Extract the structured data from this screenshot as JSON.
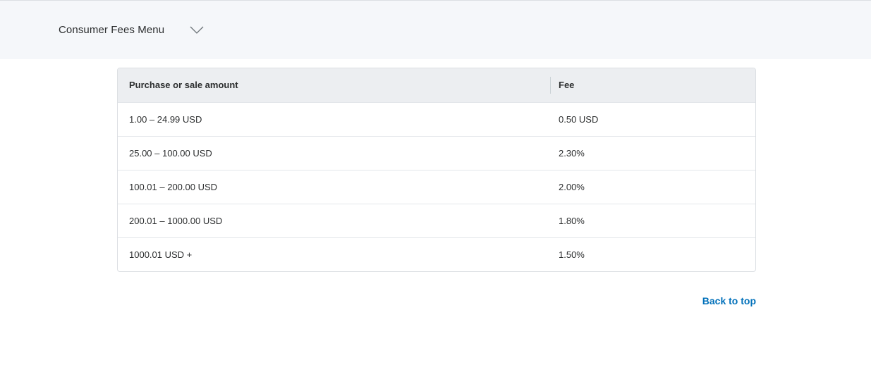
{
  "menu": {
    "label": "Consumer Fees Menu",
    "chevron_icon": "chevron-down-icon"
  },
  "table": {
    "headers": {
      "amount": "Purchase or sale amount",
      "fee": "Fee"
    },
    "rows": [
      {
        "amount": "1.00 – 24.99 USD",
        "fee": "0.50 USD"
      },
      {
        "amount": "25.00 – 100.00 USD",
        "fee": "2.30%"
      },
      {
        "amount": "100.01 – 200.00 USD",
        "fee": "2.00%"
      },
      {
        "amount": "200.01 – 1000.00 USD",
        "fee": "1.80%"
      },
      {
        "amount": "1000.01 USD +",
        "fee": "1.50%"
      }
    ]
  },
  "links": {
    "back_to_top": "Back to top"
  },
  "colors": {
    "link": "#0070ba",
    "topbar_bg": "#f5f7fa",
    "header_bg": "#eceef1"
  }
}
